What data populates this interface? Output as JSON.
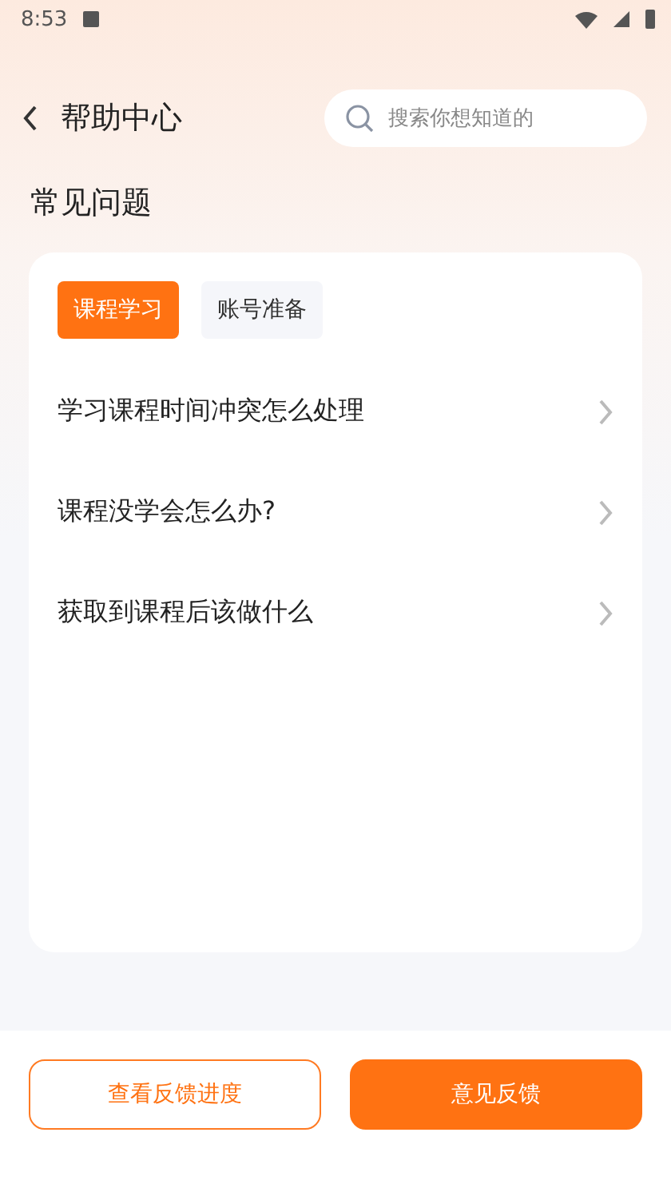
{
  "status_bar": {
    "time": "8:53"
  },
  "header": {
    "title": "帮助中心",
    "search": {
      "placeholder": "搜索你想知道的"
    }
  },
  "section_title": "常见问题",
  "tabs": [
    {
      "label": "课程学习",
      "selected": true
    },
    {
      "label": "账号准备",
      "selected": false
    }
  ],
  "questions": [
    "学习课程时间冲突怎么处理",
    "课程没学会怎么办?",
    "获取到课程后该做什么"
  ],
  "buttons": [
    {
      "label": "查看反馈进度",
      "kind": "outline"
    },
    {
      "label": "意见反馈",
      "kind": "filled"
    }
  ]
}
